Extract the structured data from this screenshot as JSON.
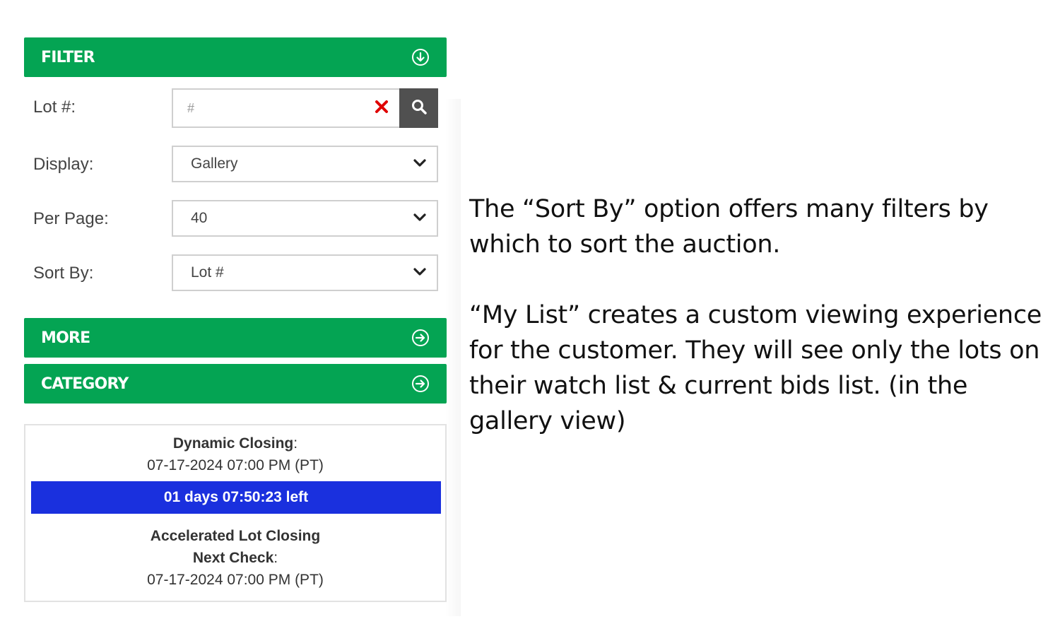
{
  "filter": {
    "title": "FILTER",
    "lot_label": "Lot #:",
    "lot_placeholder": "#",
    "display_label": "Display:",
    "display_value": "Gallery",
    "per_page_label": "Per Page:",
    "per_page_value": "40",
    "sort_label": "Sort By:",
    "sort_value": "Lot #"
  },
  "more": {
    "title": "MORE"
  },
  "category": {
    "title": "CATEGORY"
  },
  "closing": {
    "dynamic_label": "Dynamic Closing",
    "colon": ":",
    "dynamic_date": "07-17-2024 07:00 PM (PT)",
    "time_left": "01 days 07:50:23 left",
    "accelerated_line1": "Accelerated Lot Closing",
    "accelerated_line2": "Next Check",
    "next_check_date": "07-17-2024 07:00 PM (PT)"
  },
  "description": {
    "paragraph1": "The “Sort By” option offers many filters by which to sort the auction.",
    "paragraph2": "“My List” creates a custom viewing experience for the customer. They will see only the lots on their watch list & current bids list. (in the gallery view)"
  },
  "colors": {
    "green": "#04a453",
    "blue": "#1a30de",
    "search_button": "#505050",
    "clear_red": "#e00000"
  },
  "icons": {
    "filter": "circle-arrow-down-icon",
    "more": "circle-arrow-right-icon",
    "category": "circle-arrow-right-icon",
    "clear": "x-icon",
    "search": "search-icon",
    "select": "chevron-down-icon"
  }
}
